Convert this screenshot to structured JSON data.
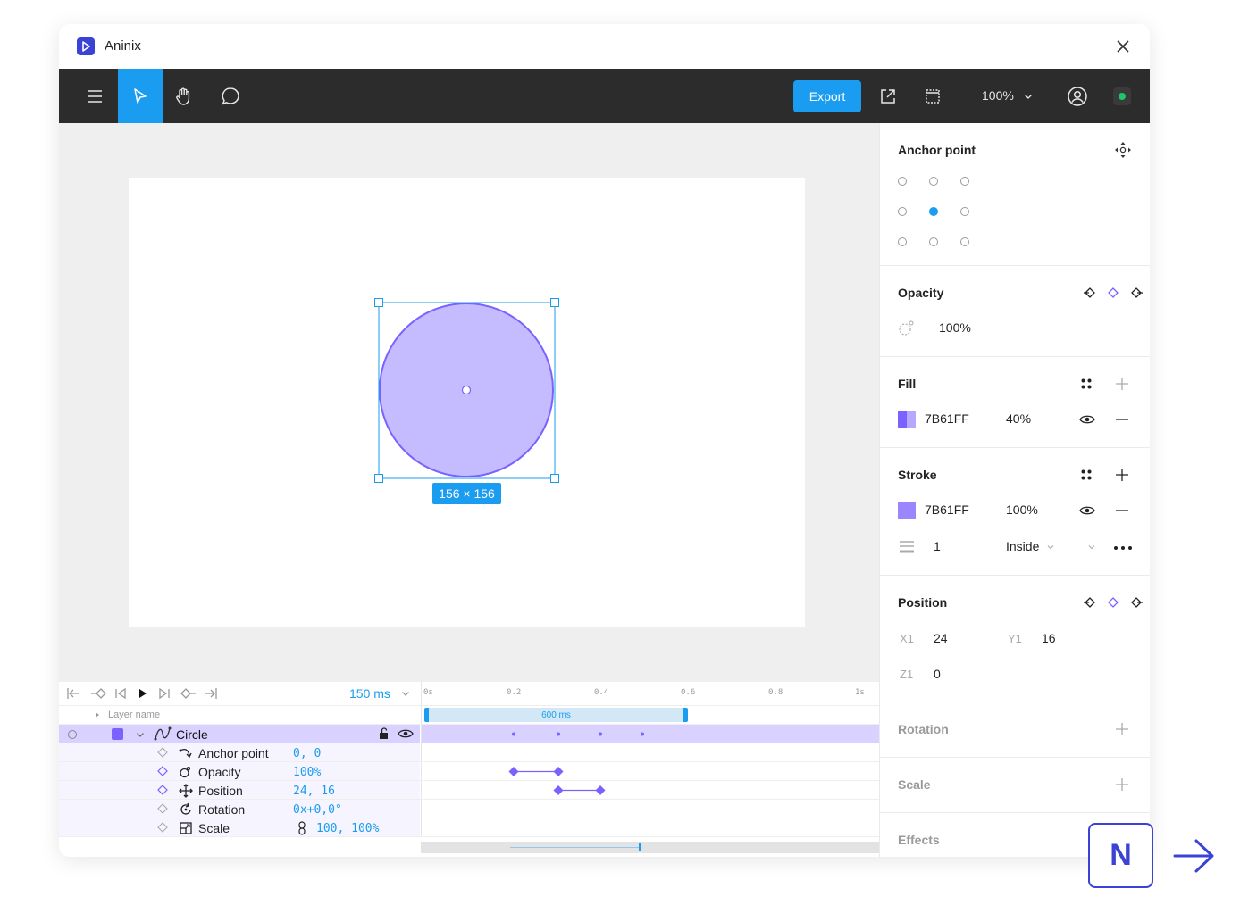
{
  "app": {
    "name": "Aninix"
  },
  "toolbar": {
    "export_label": "Export",
    "zoom": "100%",
    "status_color": "#1ec66a",
    "accent": "#1a9cf0"
  },
  "canvas": {
    "shape_fill": "#7B61FF",
    "size_label": "156 × 156"
  },
  "timeline": {
    "duration": "150 ms",
    "ruler": [
      "0s",
      "0.2",
      "0.4",
      "0.6",
      "0.8",
      "1s"
    ],
    "work_area_label": "600 ms",
    "layer_header": "Layer name",
    "layer": {
      "name": "Circle"
    },
    "properties": [
      {
        "name": "Anchor point",
        "value": "0, 0"
      },
      {
        "name": "Opacity",
        "value": "100%"
      },
      {
        "name": "Position",
        "value": "24, 16"
      },
      {
        "name": "Rotation",
        "value": "0x+0,0°"
      },
      {
        "name": "Scale",
        "value": "100, 100%"
      }
    ]
  },
  "panel": {
    "anchor": {
      "title": "Anchor point"
    },
    "opacity": {
      "title": "Opacity",
      "value": "100%"
    },
    "fill": {
      "title": "Fill",
      "hex": "7B61FF",
      "opacity": "40%",
      "color": "#7B61FF"
    },
    "stroke": {
      "title": "Stroke",
      "hex": "7B61FF",
      "opacity": "100%",
      "width": "1",
      "align": "Inside",
      "color": "#9C86FF"
    },
    "position": {
      "title": "Position",
      "x_label": "X1",
      "x": "24",
      "y_label": "Y1",
      "y": "16",
      "z_label": "Z1",
      "z": "0"
    },
    "rotation": {
      "title": "Rotation"
    },
    "scale": {
      "title": "Scale"
    },
    "effects": {
      "title": "Effects"
    }
  },
  "badge": {
    "letter": "N"
  }
}
